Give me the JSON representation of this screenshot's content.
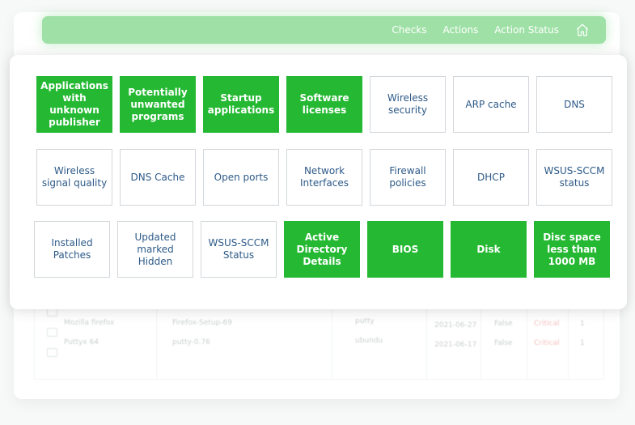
{
  "nav": {
    "links": [
      "Checks",
      "Actions",
      "Action Status"
    ],
    "home_icon": "home-icon"
  },
  "checks": [
    {
      "label": "Applications with unknown publisher",
      "selected": true
    },
    {
      "label": "Potentially unwanted programs",
      "selected": true
    },
    {
      "label": "Startup applications",
      "selected": true
    },
    {
      "label": "Software licenses",
      "selected": true
    },
    {
      "label": "Wireless security",
      "selected": false
    },
    {
      "label": "ARP cache",
      "selected": false
    },
    {
      "label": "DNS",
      "selected": false
    },
    {
      "label": "Wireless signal quality",
      "selected": false
    },
    {
      "label": "DNS Cache",
      "selected": false
    },
    {
      "label": "Open ports",
      "selected": false
    },
    {
      "label": "Network Interfaces",
      "selected": false
    },
    {
      "label": "Firewall policies",
      "selected": false
    },
    {
      "label": "DHCP",
      "selected": false
    },
    {
      "label": "WSUS-SCCM status",
      "selected": false
    },
    {
      "label": "Installed Patches",
      "selected": false
    },
    {
      "label": "Updated marked Hidden",
      "selected": false
    },
    {
      "label": "WSUS-SCCM Status",
      "selected": false
    },
    {
      "label": "Active Directory Details",
      "selected": true
    },
    {
      "label": "BIOS",
      "selected": true
    },
    {
      "label": "Disk",
      "selected": true
    },
    {
      "label": "Disc space less than 1000 MB",
      "selected": true
    }
  ],
  "background_table": {
    "rows": [
      {
        "name": "Mozilla firefox",
        "installer": "Firefox-Setup-69",
        "host": "putty",
        "date": "2021-06-27",
        "flag": "False",
        "severity": "Critical",
        "count": "1"
      },
      {
        "name": "Puttyx 64",
        "installer": "putty-0.76",
        "host": "ubundu",
        "date": "2021-06-17",
        "flag": "False",
        "severity": "Critical",
        "count": "1"
      }
    ]
  },
  "colors": {
    "selected": "#25b933",
    "unselected_text": "#2d5a88",
    "nav_bg": "#9fe0a6"
  }
}
